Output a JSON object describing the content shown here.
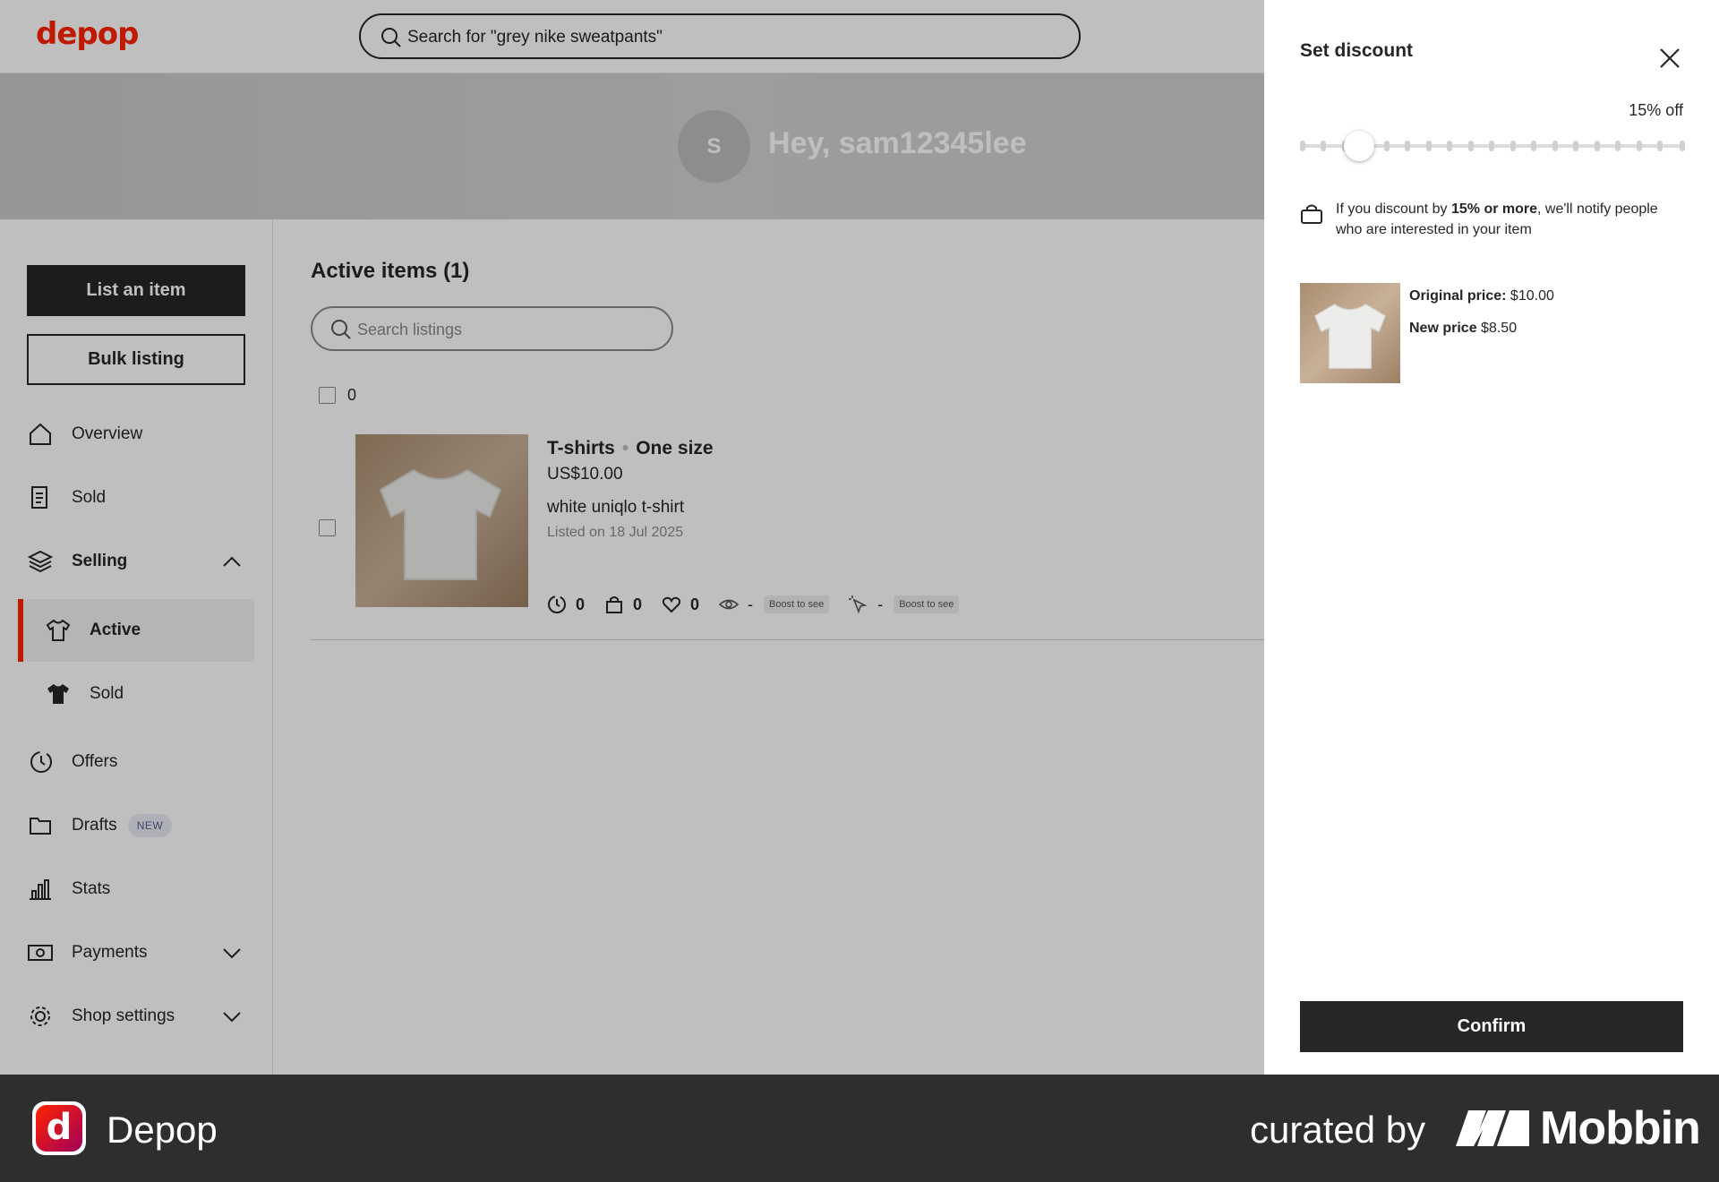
{
  "header": {
    "logo": "depop",
    "search_placeholder": "Search for \"grey nike sweatpants\""
  },
  "profile": {
    "avatar_initial": "S",
    "greeting": "Hey, sam12345lee"
  },
  "sidebar": {
    "list_item_label": "List an item",
    "bulk_listing_label": "Bulk listing",
    "items": [
      {
        "label": "Overview",
        "icon": "home-icon"
      },
      {
        "label": "Sold",
        "icon": "receipt-icon"
      },
      {
        "label": "Selling",
        "icon": "layers-icon"
      },
      {
        "label": "Active",
        "icon": "tshirt-outline-icon"
      },
      {
        "label": "Sold",
        "icon": "tshirt-filled-icon"
      },
      {
        "label": "Offers",
        "icon": "offers-icon"
      },
      {
        "label": "Drafts",
        "icon": "folder-icon",
        "badge": "NEW"
      },
      {
        "label": "Stats",
        "icon": "bar-chart-icon"
      },
      {
        "label": "Payments",
        "icon": "cash-icon"
      },
      {
        "label": "Shop settings",
        "icon": "gear-icon"
      }
    ]
  },
  "main": {
    "title": "Active items (1)",
    "search_placeholder": "Search listings",
    "selected_count": "0",
    "listing": {
      "category": "T-shirts",
      "size": "One size",
      "price": "US$10.00",
      "name": "white uniqlo t-shirt",
      "listed": "Listed on 18 Jul 2025",
      "offers": "0",
      "bag": "0",
      "likes": "0",
      "views": "-",
      "views_boost": "Boost to see",
      "clicks": "-",
      "clicks_boost": "Boost to see"
    }
  },
  "drawer": {
    "title": "Set discount",
    "discount_label": "15% off",
    "discount_percent": 15,
    "notify_pre": "If you discount by ",
    "notify_bold": "15% or more",
    "notify_post": ", we'll notify people who are interested in your item",
    "original_price_label": "Original price:",
    "original_price": "$10.00",
    "new_price_label": "New price",
    "new_price": "$8.50",
    "confirm_label": "Confirm"
  },
  "footer": {
    "app_name": "Depop",
    "app_icon_letter": "d",
    "curated_by": "curated by",
    "brand": "Mobbin"
  },
  "colors": {
    "brand_red": "#ff2300",
    "dark": "#262626",
    "footer_bg": "#2e2e2e"
  }
}
